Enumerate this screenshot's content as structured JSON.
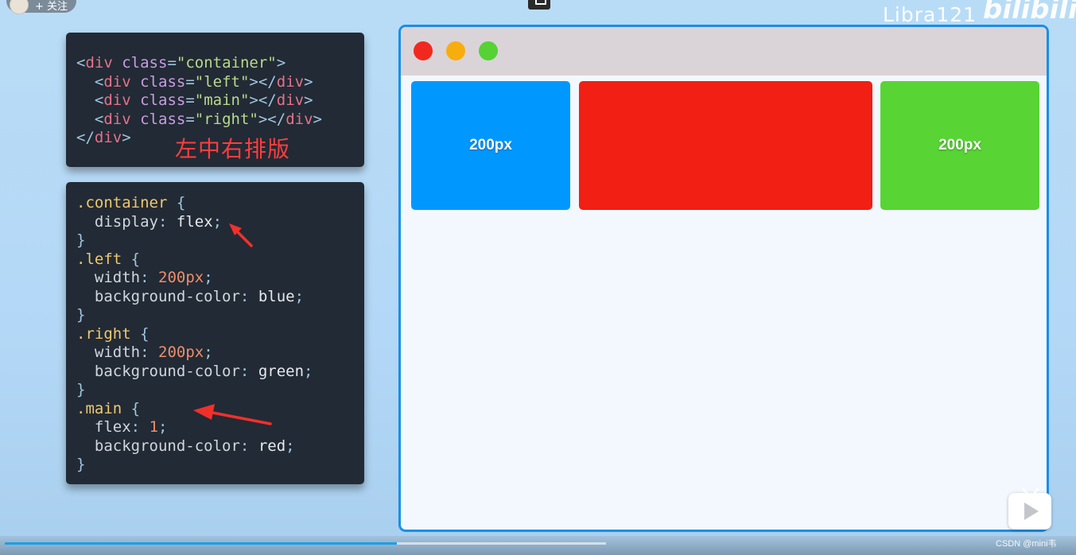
{
  "follow_pill": {
    "label": "+ 关注"
  },
  "watermark": {
    "text": "Libra121",
    "logo": "bilibili"
  },
  "html_code": {
    "lines": [
      [
        "<",
        "div",
        "class",
        "=",
        "\"container\"",
        ">"
      ],
      [
        "<",
        "div",
        "class",
        "=",
        "\"left\"",
        "></",
        "div",
        ">"
      ],
      [
        "<",
        "div",
        "class",
        "=",
        "\"main\"",
        "></",
        "div",
        ">"
      ],
      [
        "<",
        "div",
        "class",
        "=",
        "\"right\"",
        "></",
        "div",
        ">"
      ],
      [
        "</",
        "div",
        ">"
      ]
    ]
  },
  "note": {
    "text": "左中右排版"
  },
  "css_code": {
    "container_sel": ".container",
    "container_prop": "display",
    "container_val": "flex",
    "left_sel": ".left",
    "left_width_prop": "width",
    "left_width_val": "200px",
    "left_bg_prop": "background-color",
    "left_bg_val": "blue",
    "right_sel": ".right",
    "right_width_prop": "width",
    "right_width_val": "200px",
    "right_bg_prop": "background-color",
    "right_bg_val": "green",
    "main_sel": ".main",
    "main_flex_prop": "flex",
    "main_flex_val": "1",
    "main_bg_prop": "background-color",
    "main_bg_val": "red"
  },
  "preview": {
    "left_label": "200px",
    "main_label": "",
    "right_label": "200px",
    "colors": {
      "left": "#0098ff",
      "main": "#f11f14",
      "right": "#58d434",
      "close": "#f1281e",
      "minimize": "#f8ad0f",
      "maximize": "#56d234",
      "frame": "#1a8fe6"
    }
  },
  "player": {
    "progress": 0.652
  },
  "footer": {
    "credit": "CSDN @mini韦"
  }
}
